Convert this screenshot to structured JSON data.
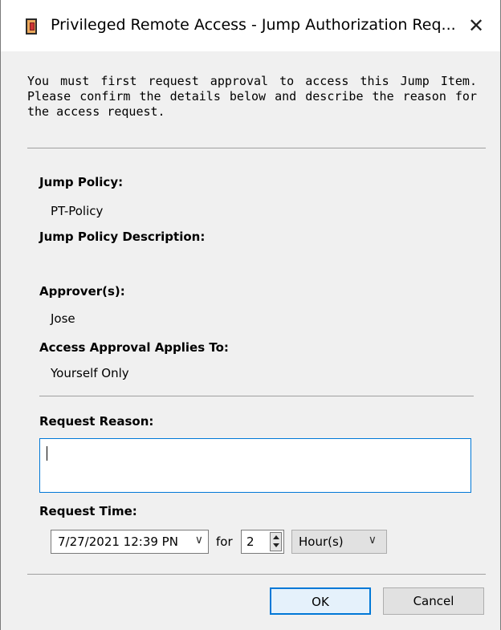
{
  "window": {
    "title": "Privileged Remote Access - Jump Authorization Req...",
    "close_glyph": "✕",
    "app_icon": "privileged-remote-access-icon"
  },
  "intro_text": "You must first request approval to access this Jump Item. Please confirm the details below and describe the reason for the access request.",
  "fields": {
    "jump_policy_label": "Jump Policy:",
    "jump_policy_value": "PT-Policy",
    "jump_policy_description_label": "Jump Policy Description:",
    "jump_policy_description_value": "",
    "approvers_label": "Approver(s):",
    "approvers_value": "Jose",
    "applies_to_label": "Access Approval Applies To:",
    "applies_to_value": "Yourself Only"
  },
  "request_reason": {
    "label": "Request Reason:",
    "value": ""
  },
  "request_time": {
    "label": "Request Time:",
    "datetime_value": "7/27/2021 12:39 PN",
    "for_label": "for",
    "duration_value": "2",
    "unit_value": "Hour(s)"
  },
  "buttons": {
    "ok": "OK",
    "cancel": "Cancel"
  },
  "colors": {
    "focus_blue": "#0078d7",
    "window_bg": "#f0f0f0"
  }
}
